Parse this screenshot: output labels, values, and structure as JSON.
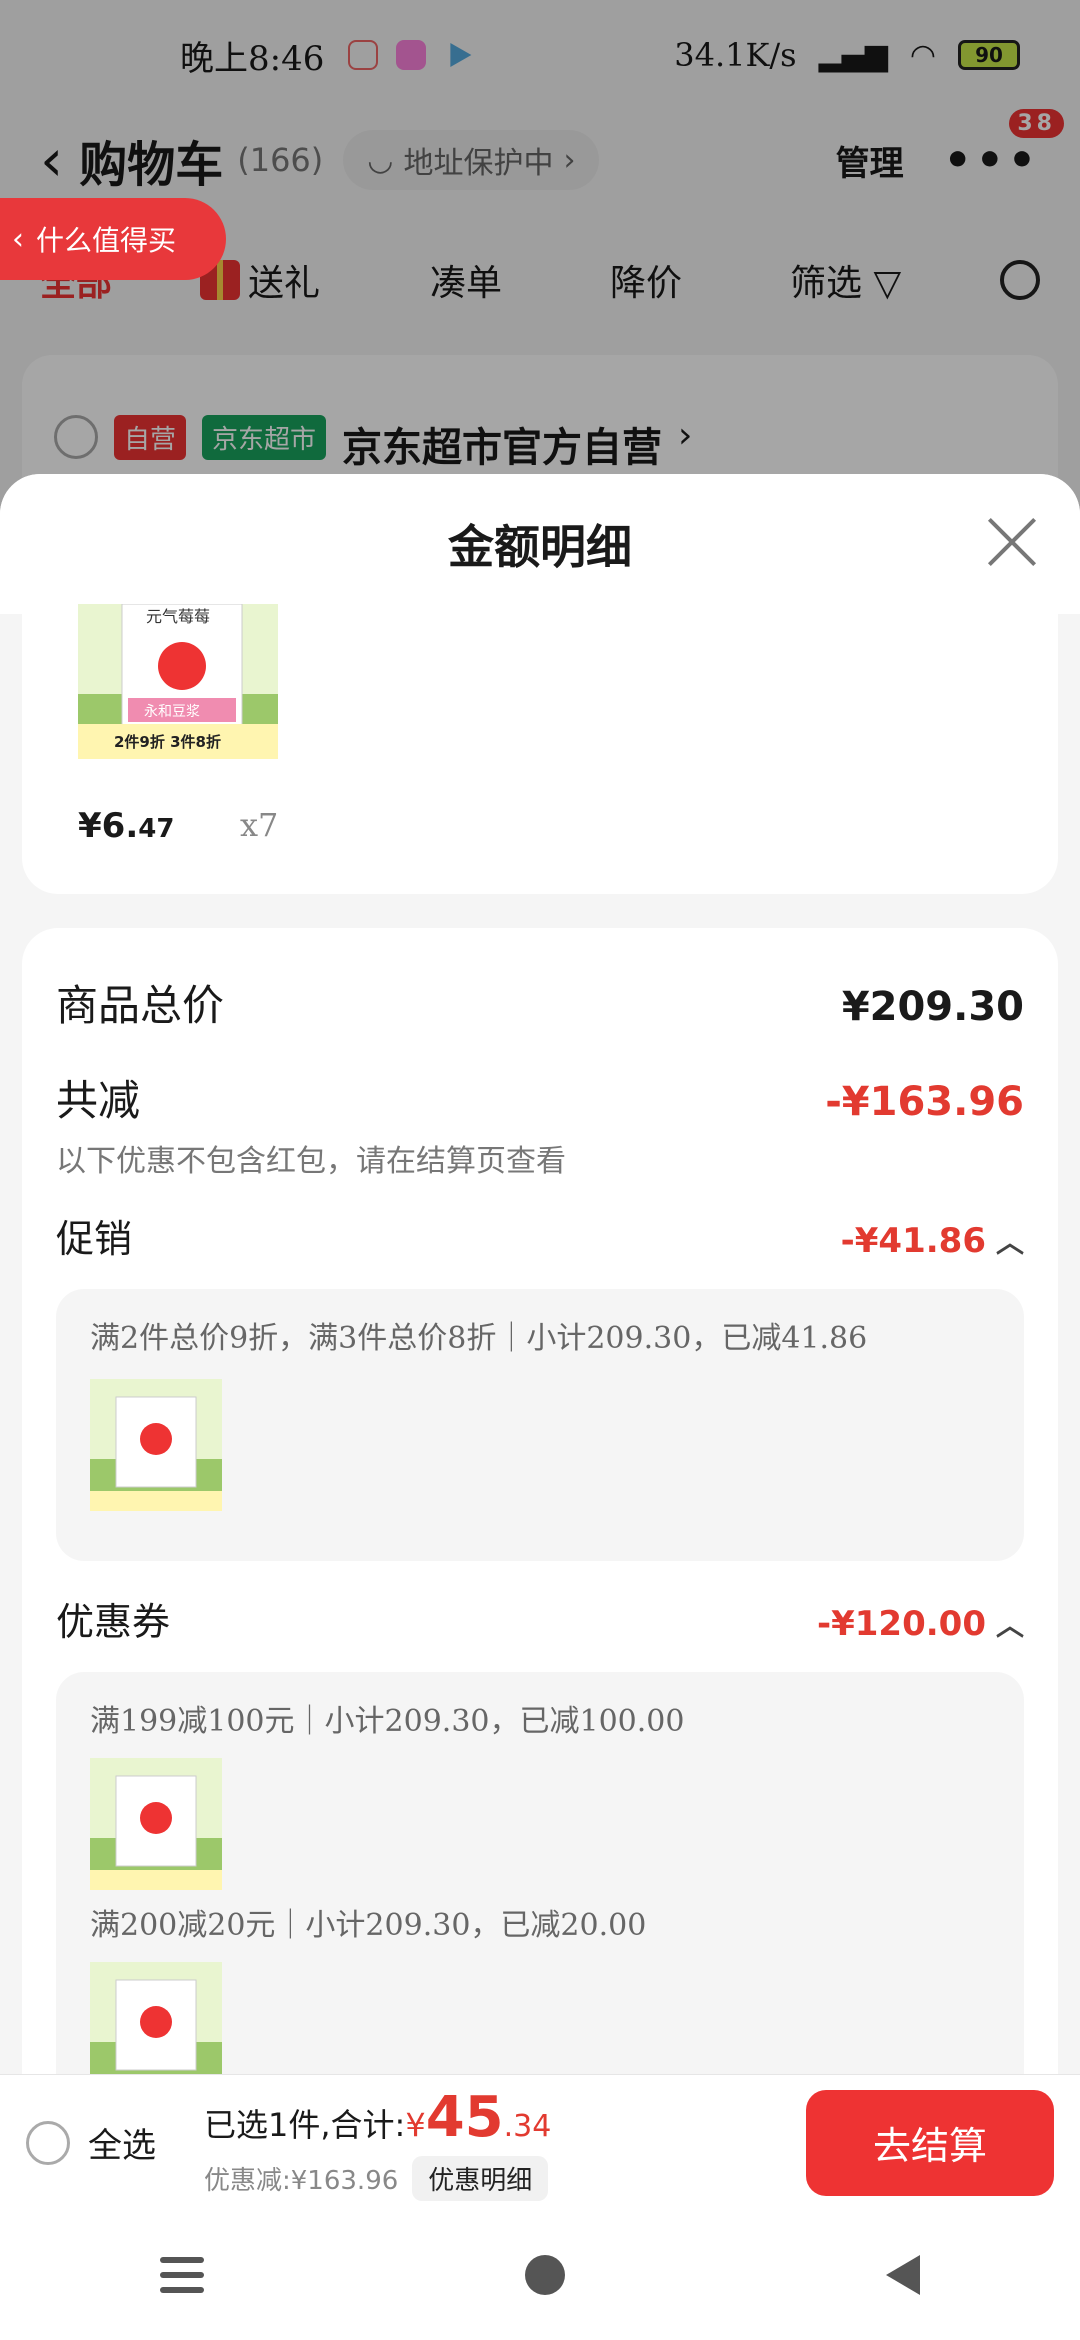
{
  "status": {
    "time": "晚上8:46",
    "speed": "34.1K/s",
    "battery": "90"
  },
  "header": {
    "title": "购物车",
    "count": "(166)",
    "address": "地址保护中",
    "manage": "管理",
    "badge": "38"
  },
  "zhide": {
    "label": "什么值得买"
  },
  "filters": {
    "all": "全部",
    "gift": "送礼",
    "combine": "凑单",
    "price_drop": "降价",
    "filter": "筛选"
  },
  "shop": {
    "tag_self": "自营",
    "tag_market": "京东超市",
    "name": "京东超市官方自营"
  },
  "sheet": {
    "title": "金额明细"
  },
  "product": {
    "thumb_title": "元气莓莓",
    "thumb_label": "永和豆浆",
    "thumb_promo": "2件9折 3件8折",
    "price_main": "¥6.",
    "price_dec": "47",
    "qty": "x7"
  },
  "detail": {
    "total_label": "商品总价",
    "total_value": "¥209.30",
    "reduce_label": "共减",
    "reduce_value": "-¥163.96",
    "reduce_hint": "以下优惠不包含红包，请在结算页查看",
    "promo_label": "促销",
    "promo_value": "-¥41.86",
    "promo_line": "满2件总价9折，满3件总价8折｜小计209.30，已减41.86",
    "coupon_label": "优惠券",
    "coupon_value": "-¥120.00",
    "coupon_line1": "满199减100元｜小计209.30，已减100.00",
    "coupon_line2": "满200减20元｜小计209.30，已减20.00"
  },
  "bottom": {
    "select_all": "全选",
    "selected": "已选1件,合计:",
    "sym": "¥",
    "sum_int": "45",
    "sum_dec": ".34",
    "discount": "优惠减:¥163.96",
    "detail_link": "优惠明细",
    "checkout": "去结算"
  }
}
